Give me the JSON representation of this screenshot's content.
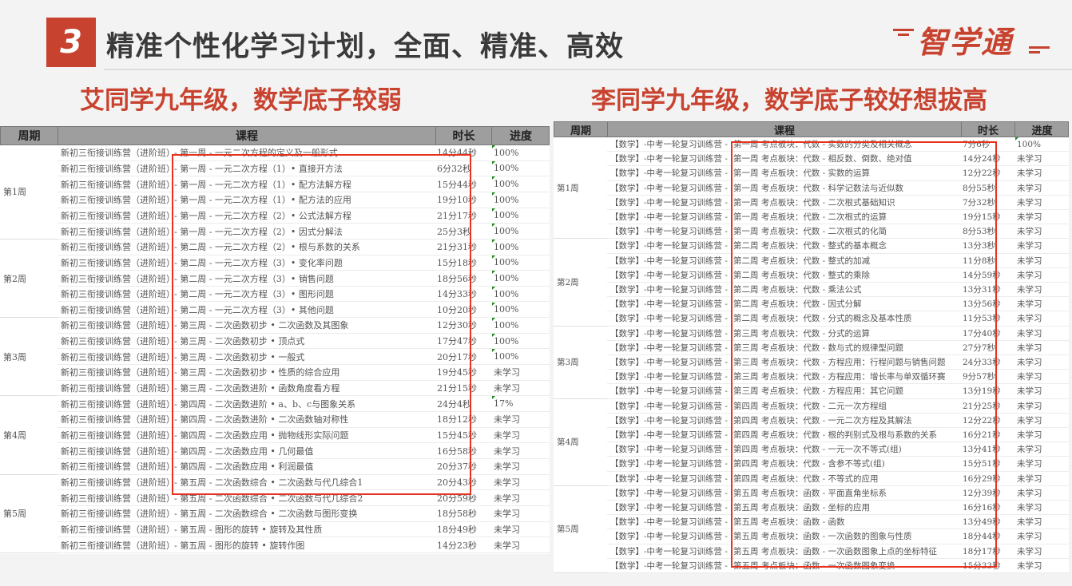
{
  "header": {
    "number": "3",
    "title": "精准个性化学习计划，全面、精准、高效",
    "logo": "智学通"
  },
  "left": {
    "subtitle": "艾同学九年级，数学底子较弱",
    "columns": [
      "周期",
      "课程",
      "时长",
      "进度"
    ],
    "prefix": "新初三衔接训练营（进阶班）",
    "weeks": [
      {
        "label": "第1周",
        "rows": 6
      },
      {
        "label": "第2周",
        "rows": 5
      },
      {
        "label": "第3周",
        "rows": 5
      },
      {
        "label": "第4周",
        "rows": 5
      },
      {
        "label": "第5周",
        "rows": 5
      }
    ],
    "rows": [
      [
        "- 第一周 - 一元二次方程的定义及一般形式",
        "14分44秒",
        "100%"
      ],
      [
        "- 第一周 - 一元二次方程（1）• 直接开方法",
        "6分32秒",
        "100%"
      ],
      [
        "- 第一周 - 一元二次方程（1）• 配方法解方程",
        "15分44秒",
        "100%"
      ],
      [
        "- 第一周 - 一元二次方程（1）• 配方法的应用",
        "19分10秒",
        "100%"
      ],
      [
        "- 第一周 - 一元二次方程（2）• 公式法解方程",
        "21分17秒",
        "100%"
      ],
      [
        "- 第一周 - 一元二次方程（2）• 因式分解法",
        "25分3秒",
        "100%"
      ],
      [
        "- 第二周 - 一元二次方程（2）• 根与系数的关系",
        "21分31秒",
        "100%"
      ],
      [
        "- 第二周 - 一元二次方程（3）• 变化率问题",
        "15分18秒",
        "100%"
      ],
      [
        "- 第二周 - 一元二次方程（3）• 销售问题",
        "18分56秒",
        "100%"
      ],
      [
        "- 第二周 - 一元二次方程（3）• 图形问题",
        "14分33秒",
        "100%"
      ],
      [
        "- 第二周 - 一元二次方程（3）• 其他问题",
        "10分20秒",
        "100%"
      ],
      [
        "- 第三周 - 二次函数初步 • 二次函数及其图象",
        "12分30秒",
        "100%"
      ],
      [
        "- 第三周 - 二次函数初步 • 顶点式",
        "17分47秒",
        "100%"
      ],
      [
        "- 第三周 - 二次函数初步 • 一般式",
        "20分17秒",
        "100%"
      ],
      [
        "- 第三周 - 二次函数初步 • 性质的综合应用",
        "19分45秒",
        "未学习"
      ],
      [
        "- 第三周 - 二次函数进阶 • 函数角度看方程",
        "21分15秒",
        "未学习"
      ],
      [
        "- 第四周 - 二次函数进阶 • a、b、c与图象关系",
        "24分4秒",
        "17%"
      ],
      [
        "- 第四周 - 二次函数进阶 • 二次函数轴对称性",
        "18分12秒",
        "未学习"
      ],
      [
        "- 第四周 - 二次函数应用 • 抛物线形实际问题",
        "15分45秒",
        "未学习"
      ],
      [
        "- 第四周 - 二次函数应用 • 几何最值",
        "16分58秒",
        "未学习"
      ],
      [
        "- 第四周 - 二次函数应用 • 利润最值",
        "20分37秒",
        "未学习"
      ],
      [
        "- 第五周 - 二次函数综合 • 二次函数与代几综合1",
        "20分43秒",
        "未学习"
      ],
      [
        "- 第五周 - 二次函数综合 • 二次函数与代几综合2",
        "20分59秒",
        "未学习"
      ],
      [
        "- 第五周 - 二次函数综合 • 二次函数与图形变换",
        "18分58秒",
        "未学习"
      ],
      [
        "- 第五周 - 图形的旋转 • 旋转及其性质",
        "18分49秒",
        "未学习"
      ],
      [
        "- 第五周 - 图形的旋转 • 旋转作图",
        "14分23秒",
        "未学习"
      ]
    ]
  },
  "right": {
    "subtitle": "李同学九年级，数学底子较好想拔高",
    "columns": [
      "周期",
      "课程",
      "时长",
      "进度"
    ],
    "prefix": "【数学】-中考一轮复习训练营 -",
    "weeks": [
      {
        "label": "第1周",
        "rows": 7
      },
      {
        "label": "第2周",
        "rows": 6
      },
      {
        "label": "第3周",
        "rows": 5
      },
      {
        "label": "第4周",
        "rows": 6
      },
      {
        "label": "第5周",
        "rows": 6
      }
    ],
    "rows": [
      [
        "第一周  考点板块：代数 - 实数的分类及相关概念",
        "7分6秒",
        "100%"
      ],
      [
        "第一周  考点板块：代数 - 相反数、倒数、绝对值",
        "14分24秒",
        "未学习"
      ],
      [
        "第一周  考点板块：代数 - 实数的运算",
        "12分22秒",
        "未学习"
      ],
      [
        "第一周  考点板块：代数 - 科学记数法与近似数",
        "8分55秒",
        "未学习"
      ],
      [
        "第一周  考点板块：代数 - 二次根式基础知识",
        "7分32秒",
        "未学习"
      ],
      [
        "第一周  考点板块：代数 - 二次根式的运算",
        "19分15秒",
        "未学习"
      ],
      [
        "第一周  考点板块：代数 - 二次根式的化简",
        "8分53秒",
        "未学习"
      ],
      [
        "第二周  考点板块：代数 - 整式的基本概念",
        "13分3秒",
        "未学习"
      ],
      [
        "第二周  考点板块：代数 - 整式的加减",
        "11分8秒",
        "未学习"
      ],
      [
        "第二周  考点板块：代数 - 整式的乘除",
        "14分59秒",
        "未学习"
      ],
      [
        "第二周  考点板块：代数 - 乘法公式",
        "13分31秒",
        "未学习"
      ],
      [
        "第二周  考点板块：代数 - 因式分解",
        "13分56秒",
        "未学习"
      ],
      [
        "第二周  考点板块：代数 - 分式的概念及基本性质",
        "11分53秒",
        "未学习"
      ],
      [
        "第三周  考点板块：代数 - 分式的运算",
        "17分40秒",
        "未学习"
      ],
      [
        "第三周  考点板块：代数 - 数与式的规律型问题",
        "27分7秒",
        "未学习"
      ],
      [
        "第三周  考点板块：代数 - 方程应用：行程问题与销售问题",
        "24分33秒",
        "未学习"
      ],
      [
        "第三周  考点板块：代数 - 方程应用：增长率与单双循环赛",
        "9分57秒",
        "未学习"
      ],
      [
        "第三周  考点板块：代数 - 方程应用：其它问题",
        "13分19秒",
        "未学习"
      ],
      [
        "第四周  考点板块：代数 - 二元一次方程组",
        "21分25秒",
        "未学习"
      ],
      [
        "第四周  考点板块：代数 - 一元二次方程及其解法",
        "12分22秒",
        "未学习"
      ],
      [
        "第四周  考点板块：代数 - 根的判别式及根与系数的关系",
        "16分21秒",
        "未学习"
      ],
      [
        "第四周  考点板块：代数 - 一元一次不等式(组)",
        "13分41秒",
        "未学习"
      ],
      [
        "第四周  考点板块：代数 - 含参不等式(组)",
        "15分51秒",
        "未学习"
      ],
      [
        "第四周  考点板块：代数 - 不等式的应用",
        "16分29秒",
        "未学习"
      ],
      [
        "第五周  考点板块：函数 - 平面直角坐标系",
        "12分39秒",
        "未学习"
      ],
      [
        "第五周  考点板块：函数 - 坐标的应用",
        "16分16秒",
        "未学习"
      ],
      [
        "第五周  考点板块：函数 - 函数",
        "13分49秒",
        "未学习"
      ],
      [
        "第五周  考点板块：函数 - 一次函数的图象与性质",
        "18分44秒",
        "未学习"
      ],
      [
        "第五周  考点板块：函数 - 一次函数图象上点的坐标特征",
        "18分17秒",
        "未学习"
      ],
      [
        "第五周  考点板块：函数 - 一次函数图象变换",
        "15分33秒",
        "未学习"
      ]
    ]
  }
}
